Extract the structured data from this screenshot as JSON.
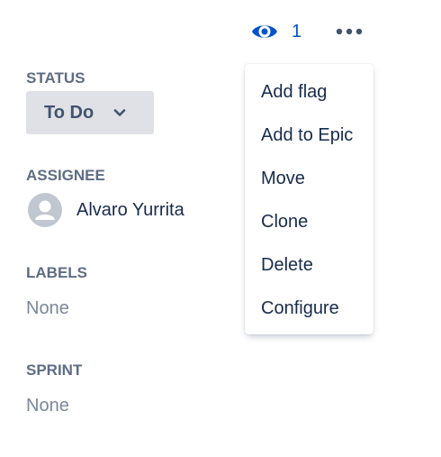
{
  "header": {
    "watch_count": "1",
    "more_icon": "more-horizontal-icon",
    "watch_icon": "eye-icon"
  },
  "status": {
    "label": "STATUS",
    "value": "To Do"
  },
  "assignee": {
    "label": "ASSIGNEE",
    "name": "Alvaro Yurrita"
  },
  "labels": {
    "label": "LABELS",
    "value": "None"
  },
  "sprint": {
    "label": "SPRINT",
    "value": "None"
  },
  "menu": {
    "items": [
      "Add flag",
      "Add to Epic",
      "Move",
      "Clone",
      "Delete",
      "Configure"
    ]
  },
  "colors": {
    "accent": "#0052cc",
    "label_gray": "#5e6c84",
    "status_bg": "#dfe1e6",
    "muted": "#7a869a"
  }
}
